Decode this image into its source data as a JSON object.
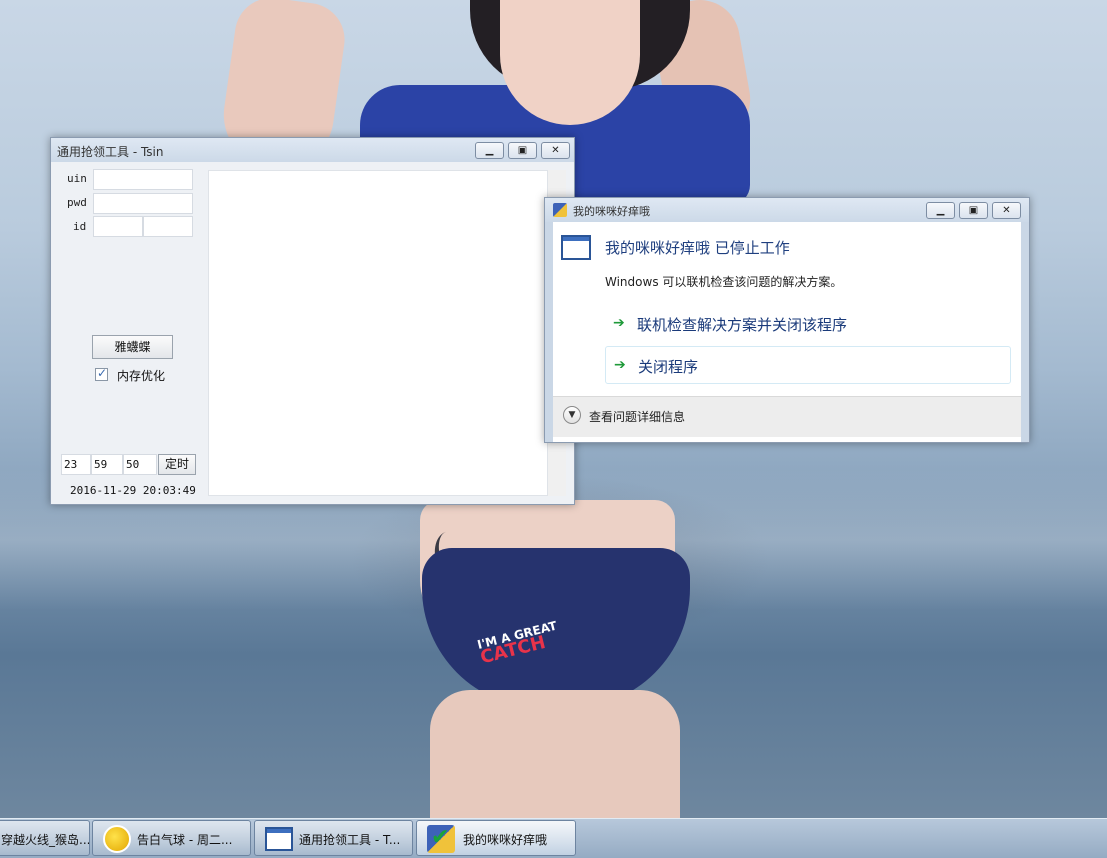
{
  "tool_window": {
    "title": "通用抢领工具 - Tsin",
    "fields": {
      "uin_label": "uin",
      "pwd_label": "pwd",
      "id_label": "id"
    },
    "action_button": "雅蠛蝶",
    "memory_checkbox": {
      "label": "内存优化",
      "checked": true
    },
    "time": {
      "hour": "23",
      "minute": "59",
      "second": "50"
    },
    "timer_button": "定时",
    "datetime": "2016-11-29 20:03:49"
  },
  "crash_dialog": {
    "title": "我的咪咪好痒哦",
    "heading": "我的咪咪好痒哦 已停止工作",
    "subtext": "Windows 可以联机检查该问题的解决方案。",
    "options": [
      {
        "label": "联机检查解决方案并关闭该程序"
      },
      {
        "label": "关闭程序"
      }
    ],
    "details_label": "查看问题详细信息"
  },
  "wallpaper": {
    "print_line1": "I'M A GREAT",
    "print_line2": "CATCH"
  },
  "taskbar": {
    "items": [
      {
        "label": "穿越火线_猴岛..."
      },
      {
        "label": "告白气球 - 周二..."
      },
      {
        "label": "通用抢领工具 - T..."
      },
      {
        "label": "我的咪咪好痒哦"
      }
    ]
  }
}
